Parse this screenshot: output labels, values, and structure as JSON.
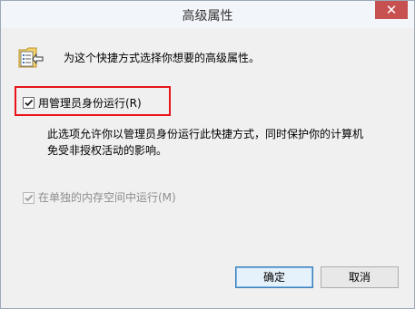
{
  "window": {
    "title": "高级属性",
    "close_glyph": "✕"
  },
  "header": {
    "icon": "shortcut-properties-icon",
    "text": "为这个快捷方式选择你想要的高级属性。"
  },
  "options": {
    "run_as_admin": {
      "label": "用管理员身份运行(R)",
      "checked": true,
      "enabled": true,
      "description_line1": "此选项允许你以管理员身份运行此快捷方式，同时保护你的计算机",
      "description_line2": "免受非授权活动的影响。"
    },
    "separate_memory": {
      "label": "在单独的内存空间中运行(M)",
      "checked": true,
      "enabled": false
    }
  },
  "buttons": {
    "ok_label": "确定",
    "cancel_label": "取消"
  },
  "colors": {
    "highlight_border": "#e8141a",
    "close_button": "#c75050"
  }
}
